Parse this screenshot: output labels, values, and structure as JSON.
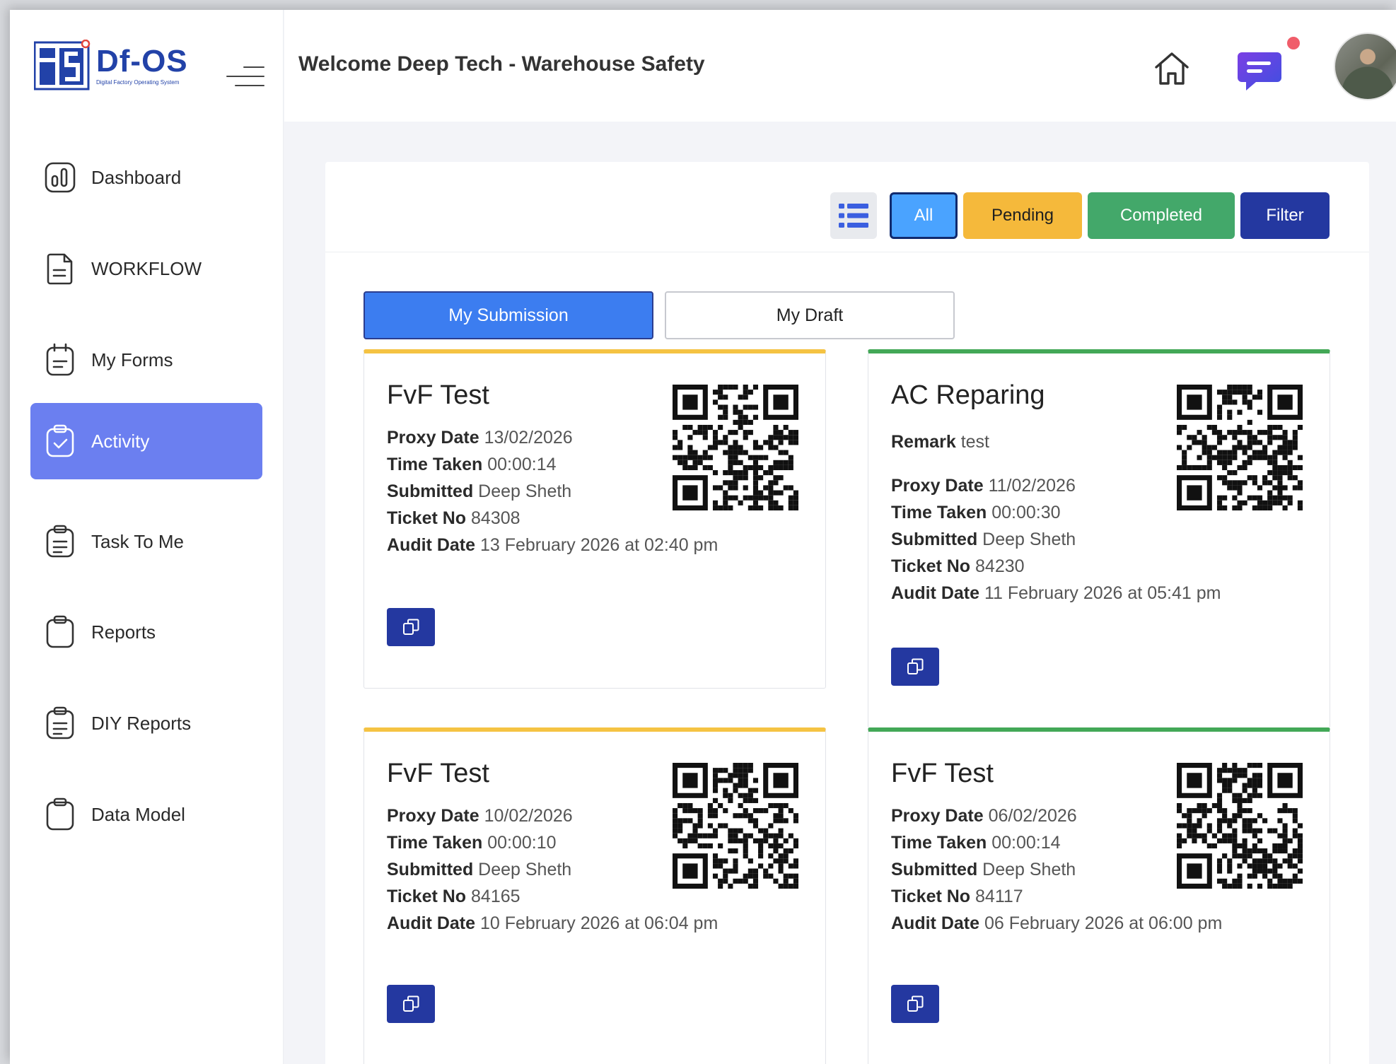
{
  "brand": {
    "name": "Df-OS",
    "tagline": "Digital Factory Operating System",
    "primary_color": "#2242a8"
  },
  "header": {
    "welcome": "Welcome Deep Tech - Warehouse Safety",
    "icons": [
      "home-icon",
      "chat-icon",
      "avatar"
    ],
    "has_notification": true
  },
  "sidebar": {
    "items": [
      {
        "label": "Dashboard",
        "icon": "dashboard-icon",
        "active": false
      },
      {
        "label": "WORKFLOW",
        "icon": "document-icon",
        "active": false
      },
      {
        "label": "My Forms",
        "icon": "forms-icon",
        "active": false
      },
      {
        "label": "Activity",
        "icon": "clipboard-check-icon",
        "active": true
      },
      {
        "label": "Task To Me",
        "icon": "clipboard-list-icon",
        "active": false
      },
      {
        "label": "Reports",
        "icon": "clipboard-icon",
        "active": false
      },
      {
        "label": "DIY Reports",
        "icon": "clipboard-list-icon",
        "active": false
      },
      {
        "label": "Data Model",
        "icon": "clipboard-icon",
        "active": false
      }
    ],
    "active_color": "#6b7ff0"
  },
  "filters": {
    "all": "All",
    "pending": "Pending",
    "completed": "Completed",
    "filter": "Filter",
    "selected": "All"
  },
  "tabs": {
    "my_submission": "My Submission",
    "my_draft": "My Draft",
    "selected": "My Submission"
  },
  "labels": {
    "proxy_date": "Proxy Date",
    "time_taken": "Time Taken",
    "submitted": "Submitted",
    "ticket_no": "Ticket No",
    "audit_date": "Audit Date",
    "remark": "Remark"
  },
  "cards": [
    {
      "title": "FvF Test",
      "status": "pending",
      "proxy_date": "13/02/2026",
      "time_taken": "00:00:14",
      "submitted": "Deep Sheth",
      "ticket_no": "84308",
      "audit_date": "13 February 2026 at 02:40 pm"
    },
    {
      "title": "AC Reparing",
      "status": "completed",
      "remark": "test",
      "proxy_date": "11/02/2026",
      "time_taken": "00:00:30",
      "submitted": "Deep Sheth",
      "ticket_no": "84230",
      "audit_date": "11 February 2026 at 05:41 pm"
    },
    {
      "title": "FvF Test",
      "status": "pending",
      "proxy_date": "10/02/2026",
      "time_taken": "00:00:10",
      "submitted": "Deep Sheth",
      "ticket_no": "84165",
      "audit_date": "10 February 2026 at 06:04 pm"
    },
    {
      "title": "FvF Test",
      "status": "completed",
      "proxy_date": "06/02/2026",
      "time_taken": "00:00:14",
      "submitted": "Deep Sheth",
      "ticket_no": "84117",
      "audit_date": "06 February 2026 at 06:00 pm"
    }
  ],
  "status_colors": {
    "pending": "#f5c343",
    "completed": "#43a857"
  }
}
